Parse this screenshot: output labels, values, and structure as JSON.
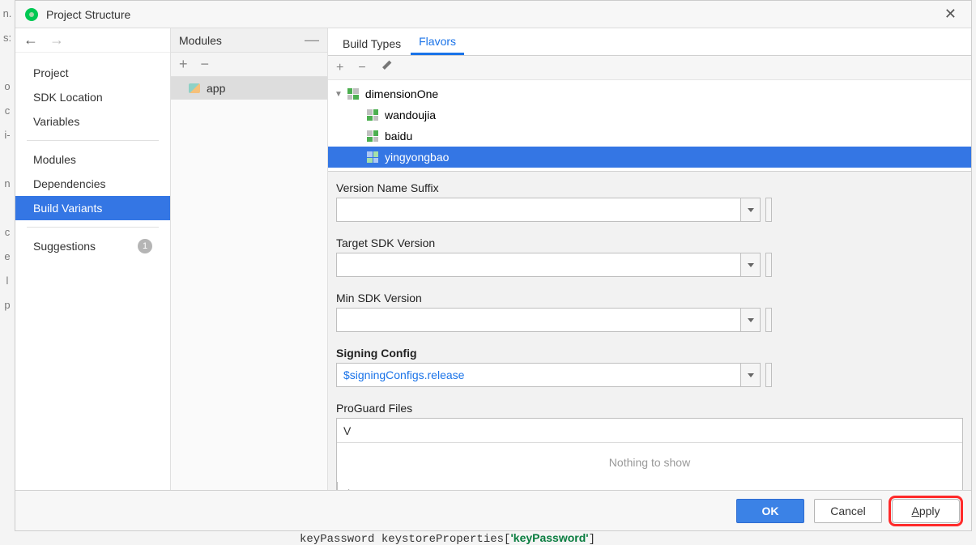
{
  "window": {
    "title": "Project Structure"
  },
  "nav": {
    "group1": [
      "Project",
      "SDK Location",
      "Variables"
    ],
    "group2": [
      "Modules",
      "Dependencies",
      "Build Variants"
    ],
    "group3_label": "Suggestions",
    "suggestions_badge": "1",
    "selected": "Build Variants"
  },
  "modules": {
    "header": "Modules",
    "items": [
      "app"
    ]
  },
  "tabs": {
    "items": [
      "Build Types",
      "Flavors"
    ],
    "active": "Flavors"
  },
  "tree": {
    "root": "dimensionOne",
    "children": [
      "wandoujia",
      "baidu",
      "yingyongbao"
    ],
    "selected": "yingyongbao"
  },
  "form": {
    "version_name_suffix": {
      "label": "Version Name Suffix",
      "value": ""
    },
    "target_sdk": {
      "label": "Target SDK Version",
      "value": ""
    },
    "min_sdk": {
      "label": "Min SDK Version",
      "value": ""
    },
    "signing": {
      "label": "Signing Config",
      "value": "$signingConfigs.release"
    },
    "proguard": {
      "label": "ProGuard Files",
      "input": "V",
      "empty": "Nothing to show"
    }
  },
  "footer": {
    "ok": "OK",
    "cancel": "Cancel",
    "apply": "Apply"
  },
  "bgcode": "keyPassword keystoreProperties['keyPassword']"
}
